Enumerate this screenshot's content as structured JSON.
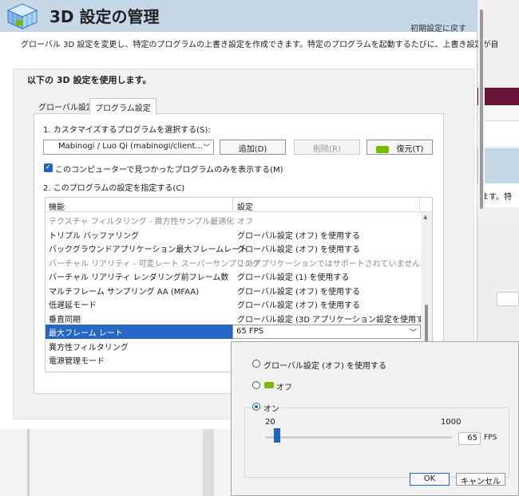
{
  "header": {
    "title": "3D 設定の管理",
    "restore_defaults": "初期設定に戻す"
  },
  "description": "グローバル 3D 設定を変更し、特定のプログラムの上書き設定を作成できます。特定のプログラムを起動するたびに、上書き設定が自",
  "section_title": "以下の 3D 設定を使用します。",
  "tabs": [
    {
      "label": "グローバル設定"
    },
    {
      "label": "プログラム設定"
    }
  ],
  "program": {
    "select_label": "1. カスタマイズするプログラムを選択する(S):",
    "selected": "Mabinogi / Luo Qi (mabinogi/client...",
    "add_button": "追加(D)",
    "remove_button": "削除(R)",
    "restore_button": "復元(T)",
    "only_found_label": "このコンピューターで見つかったプログラムのみを表示する(M)",
    "settings_label": "2. このプログラムの設定を指定する(C)"
  },
  "grid": {
    "col_feature": "機能",
    "col_setting": "設定",
    "rows": [
      {
        "feature": "テクスチャ フィルタリング - 異方性サンプル最適化",
        "setting": "オフ"
      },
      {
        "feature": "トリプル バッファリング",
        "setting": "グローバル設定 (オフ) を使用する"
      },
      {
        "feature": "バックグラウンドアプリケーション最大フレームレート",
        "setting": "グローバル設定 (オフ) を使用する"
      },
      {
        "feature": "バーチャル リアリティ - 可変レート スーパーサンプリング",
        "setting": "このアプリケーションではサポートされていません"
      },
      {
        "feature": "バーチャル リアリティ レンダリング前フレーム数",
        "setting": "グローバル設定 (1) を使用する"
      },
      {
        "feature": "マルチフレーム サンプリング AA (MFAA)",
        "setting": "グローバル設定 (オフ) を使用する"
      },
      {
        "feature": "低遅延モード",
        "setting": "グローバル設定 (オフ) を使用する"
      },
      {
        "feature": "垂直同期",
        "setting": "グローバル設定 (3D アプリケーション設定を使用する) ..."
      },
      {
        "feature": "最大フレーム レート",
        "setting": "65 FPS"
      },
      {
        "feature": "異方性フィルタリング",
        "setting": ""
      },
      {
        "feature": "電源管理モード",
        "setting": ""
      }
    ]
  },
  "popup": {
    "option_global": "グローバル設定 (オフ) を使用する",
    "option_off": "オフ",
    "option_on": "オン",
    "slider_min": "20",
    "slider_max": "1000",
    "fps_value": "65",
    "fps_unit": "FPS",
    "ok": "OK",
    "cancel": "キャンセル"
  },
  "background": {
    "right_text": "ます。特"
  },
  "colors": {
    "header_bg": "#c6d7e8",
    "accent": "#1d64c0",
    "selection": "#2767c4",
    "nvidia_green": "#76b900",
    "bg_window_maroon": "#6b1439"
  }
}
